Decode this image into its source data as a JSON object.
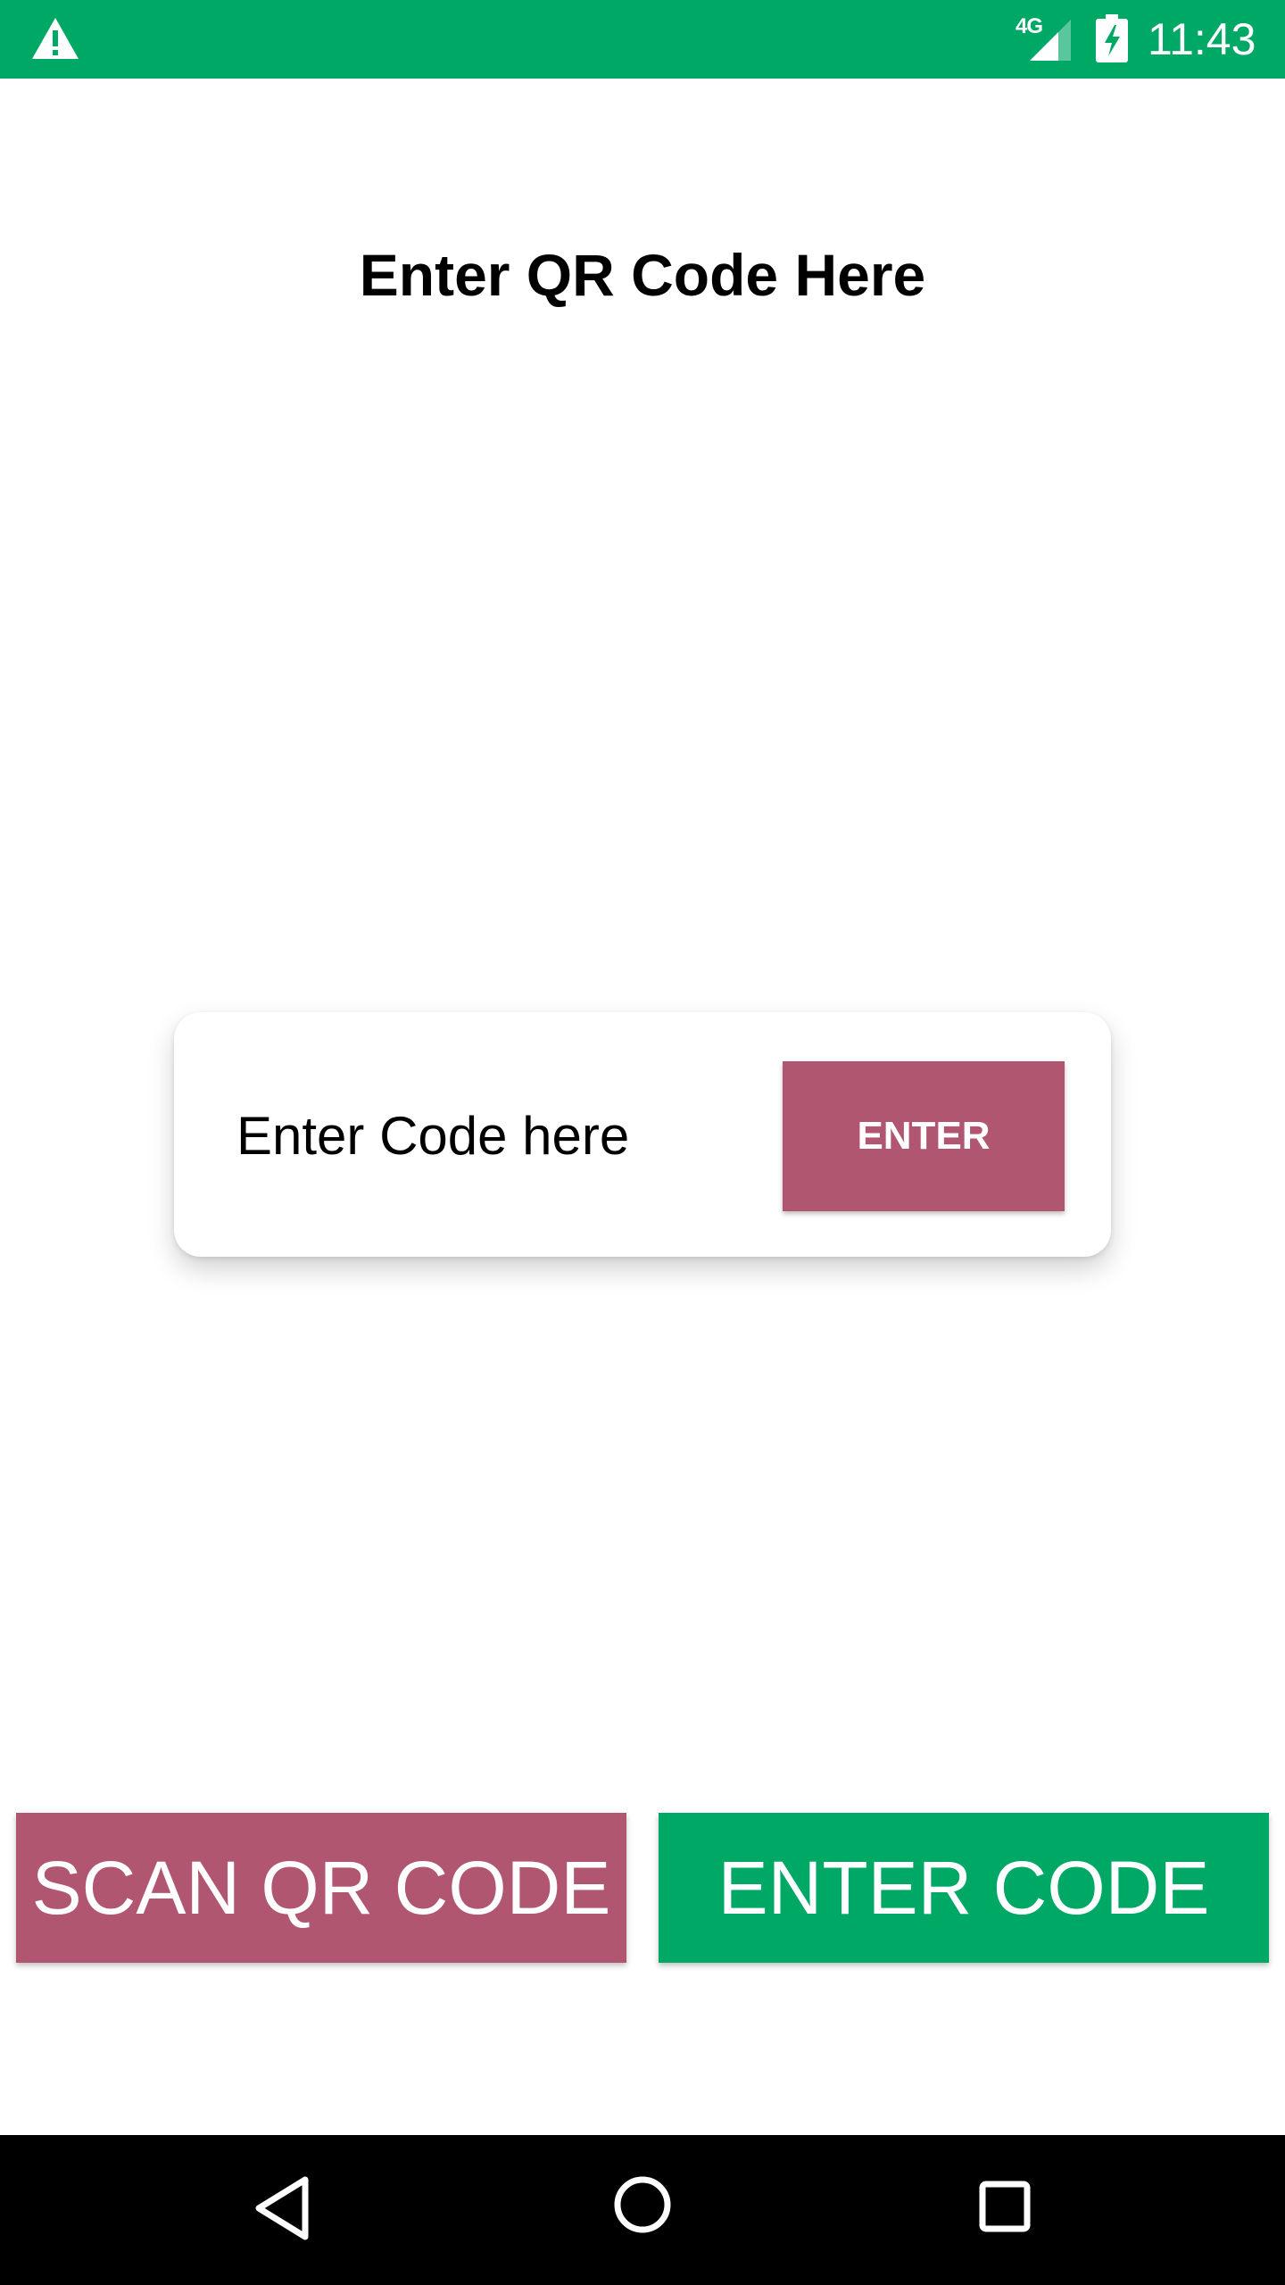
{
  "status_bar": {
    "time": "11:43",
    "network": "4G",
    "warning_icon": "warning-icon",
    "signal_icon": "cell-signal-icon",
    "battery_icon": "battery-charging-icon",
    "color": "#00a866"
  },
  "title": "Enter QR Code Here",
  "code_card": {
    "input_placeholder": "Enter Code here",
    "input_value": "",
    "enter_label": "ENTER"
  },
  "actions": {
    "scan_label": "SCAN QR CODE",
    "enter_code_label": "ENTER CODE"
  },
  "nav_bar": {
    "back_icon": "back-triangle-icon",
    "home_icon": "home-circle-icon",
    "recents_icon": "recents-square-icon"
  },
  "colors": {
    "primary_green": "#00a866",
    "accent_rose": "#b15671"
  }
}
